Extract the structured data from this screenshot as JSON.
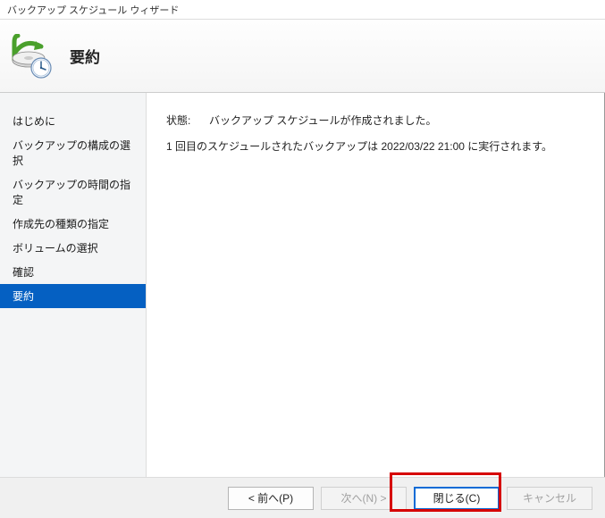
{
  "window": {
    "title": "バックアップ スケジュール ウィザード"
  },
  "header": {
    "title": "要約"
  },
  "sidebar": {
    "items": [
      {
        "label": "はじめに"
      },
      {
        "label": "バックアップの構成の選択"
      },
      {
        "label": "バックアップの時間の指定"
      },
      {
        "label": "作成先の種類の指定"
      },
      {
        "label": "ボリュームの選択"
      },
      {
        "label": "確認"
      },
      {
        "label": "要約"
      }
    ],
    "activeIndex": 6
  },
  "content": {
    "status_label": "状態:",
    "status_value": "バックアップ スケジュールが作成されました。",
    "detail": "1 回目のスケジュールされたバックアップは 2022/03/22 21:00 に実行されます。"
  },
  "footer": {
    "prev": "< 前へ(P)",
    "next": "次へ(N) >",
    "close": "閉じる(C)",
    "cancel": "キャンセル"
  }
}
